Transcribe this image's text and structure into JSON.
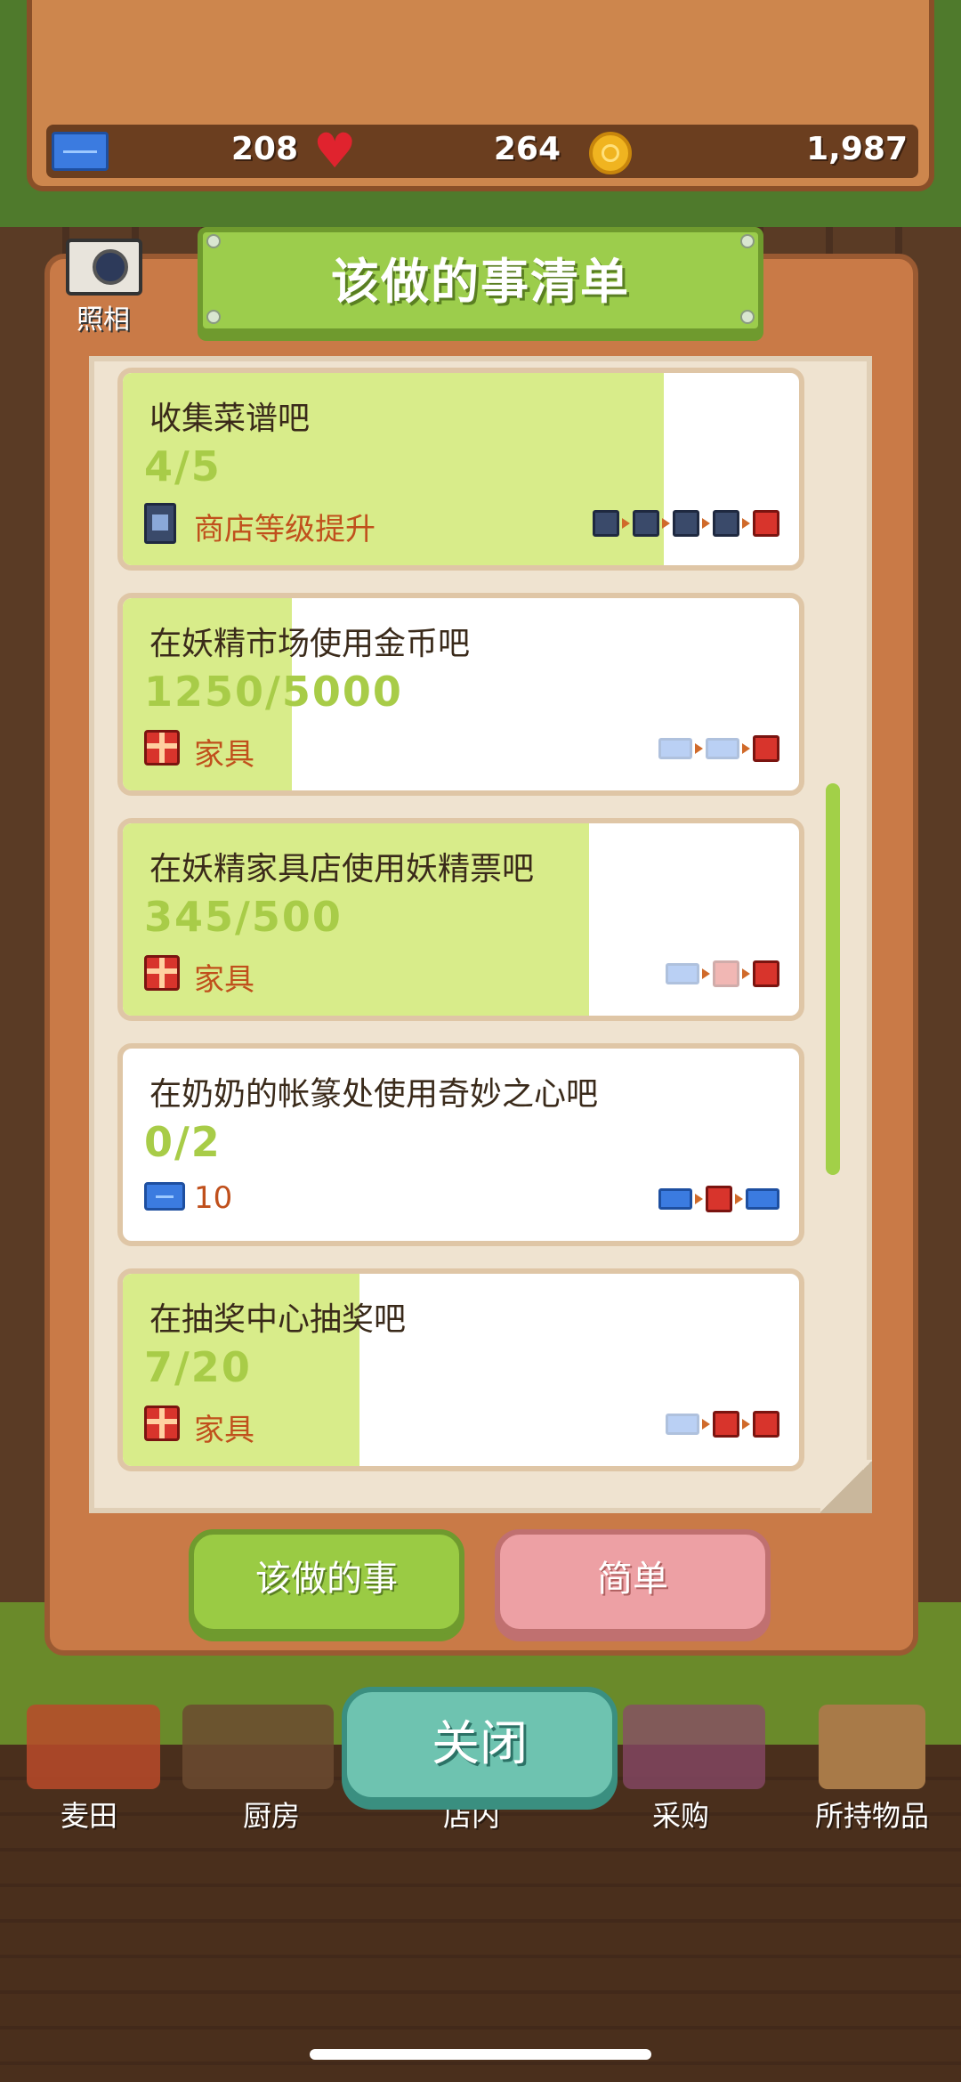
{
  "stats": {
    "tickets": "208",
    "hearts": "264",
    "coins": "1,987"
  },
  "camera": {
    "label": "照相"
  },
  "title": "该做的事清单",
  "tasks": [
    {
      "title": "收集菜谱吧",
      "progress": "4/5",
      "reward": "商店等级提升",
      "reward_icon": "shop-icon",
      "fill_fraction": 0.8
    },
    {
      "title": "在妖精市场使用金币吧",
      "progress": "1250/5000",
      "reward": "家具",
      "reward_icon": "gift-icon",
      "fill_fraction": 0.25
    },
    {
      "title": "在妖精家具店使用妖精票吧",
      "progress": "345/500",
      "reward": "家具",
      "reward_icon": "gift-icon",
      "fill_fraction": 0.69
    },
    {
      "title": "在奶奶的帐篆处使用奇妙之心吧",
      "progress": "0/2",
      "reward": "10",
      "reward_icon": "ticket-icon",
      "fill_fraction": 0
    },
    {
      "title": "在抽奖中心抽奖吧",
      "progress": "7/20",
      "reward": "家具",
      "reward_icon": "gift-icon",
      "fill_fraction": 0.35
    }
  ],
  "tabs": {
    "todo": "该做的事",
    "simple": "简单"
  },
  "close_label": "关闭",
  "nav": [
    "麦田",
    "厨房",
    "店内",
    "采购",
    "所持物品"
  ]
}
